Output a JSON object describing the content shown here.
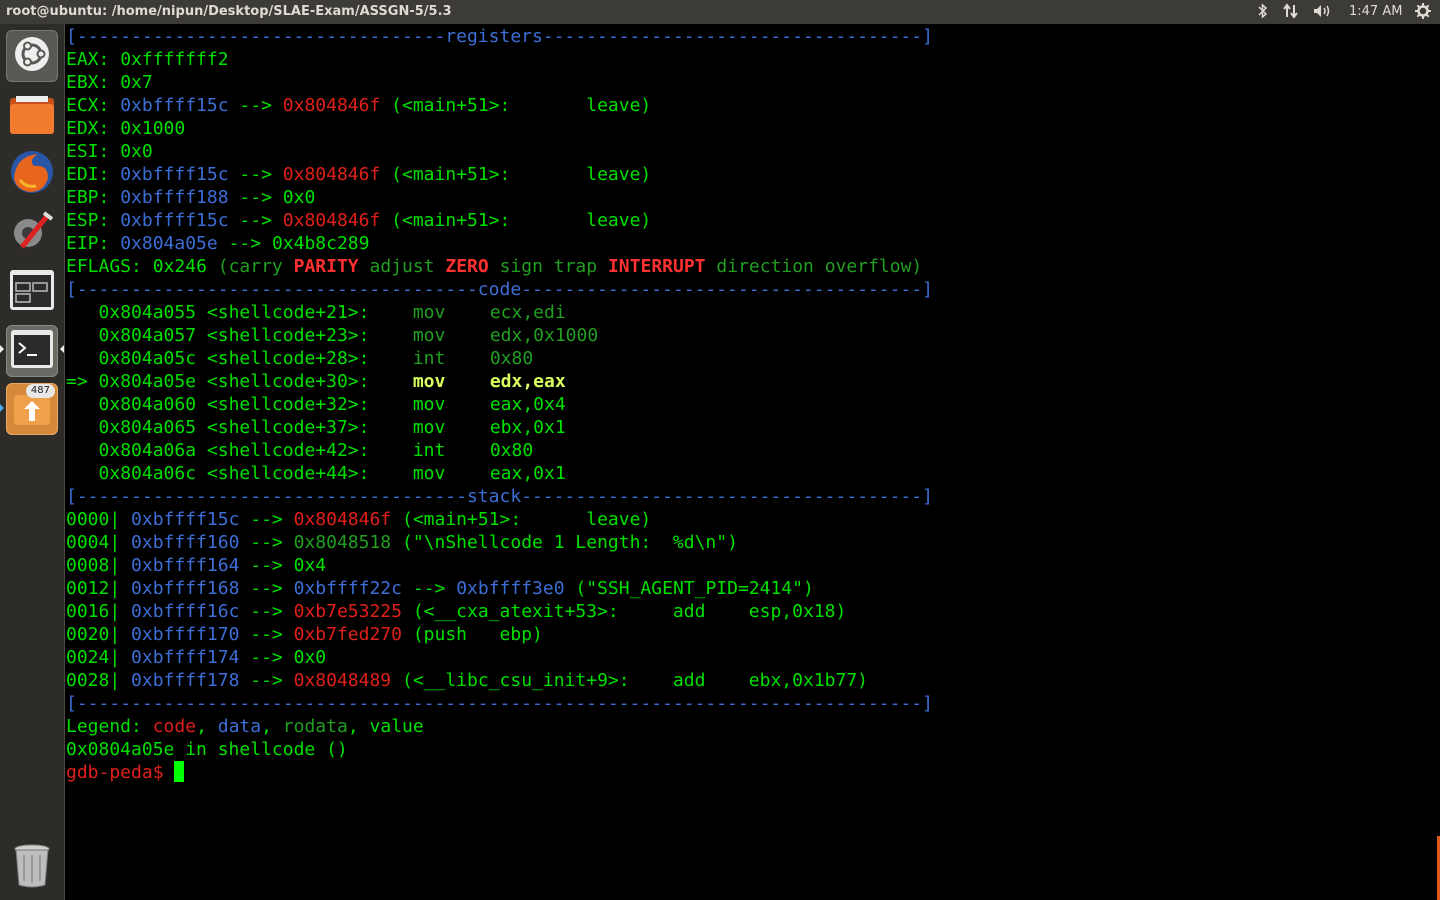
{
  "window": {
    "title": "root@ubuntu: /home/nipun/Desktop/SLAE-Exam/ASSGN-5/5.3"
  },
  "tray": {
    "bluetooth": "bluetooth-icon",
    "network": "network-icon",
    "volume": "volume-icon",
    "clock": "1:47 AM",
    "settings": "gear-icon"
  },
  "launcher": {
    "items": [
      {
        "name": "dash-home",
        "icon": "ubuntu-logo-icon"
      },
      {
        "name": "files",
        "icon": "folder-icon"
      },
      {
        "name": "firefox",
        "icon": "firefox-icon"
      },
      {
        "name": "system-settings",
        "icon": "settings-tools-icon"
      },
      {
        "name": "workspace-switcher",
        "icon": "workspace-icon"
      },
      {
        "name": "terminal",
        "icon": "terminal-icon"
      },
      {
        "name": "software-updater",
        "icon": "updater-icon",
        "badge": "487"
      },
      {
        "name": "trash",
        "icon": "trash-icon"
      }
    ]
  },
  "colors": {
    "blue": "#3d6ed6",
    "red": "#e0201a",
    "green": "#00e000",
    "dim": "#229e22",
    "yellow": "#d8ff60"
  },
  "terminal": {
    "registers_header": "[----------------------------------registers-----------------------------------]",
    "code_header": "[-------------------------------------code-------------------------------------]",
    "stack_header": "[------------------------------------stack-------------------------------------]",
    "end_rule": "[------------------------------------------------------------------------------]",
    "regs": {
      "eax": {
        "n": "EAX",
        "v": "0xfffffff2"
      },
      "ebx": {
        "n": "EBX",
        "v": "0x7"
      },
      "ecx": {
        "n": "ECX",
        "v": "0xbffff15c",
        "arrow": "-->",
        "t": "0x804846f",
        "d": "(<main+51>:       leave)"
      },
      "edx": {
        "n": "EDX",
        "v": "0x1000"
      },
      "esi": {
        "n": "ESI",
        "v": "0x0"
      },
      "edi": {
        "n": "EDI",
        "v": "0xbffff15c",
        "arrow": "-->",
        "t": "0x804846f",
        "d": "(<main+51>:       leave)"
      },
      "ebp": {
        "n": "EBP",
        "v": "0xbffff188",
        "arrow": "-->",
        "t": "0x0"
      },
      "esp": {
        "n": "ESP",
        "v": "0xbffff15c",
        "arrow": "-->",
        "t": "0x804846f",
        "d": "(<main+51>:       leave)"
      },
      "eip": {
        "n": "EIP",
        "v": "0x804a05e",
        "arrow": "-->",
        "t": "0x4b8c289"
      }
    },
    "eflags": {
      "n": "EFLAGS",
      "v": "0x246",
      "f1": "(carry",
      "f2": "PARITY",
      "f3": "adjust",
      "f4": "ZERO",
      "f5": "sign trap",
      "f6": "INTERRUPT",
      "f7": "direction overflow)"
    },
    "code": [
      {
        "m": "   ",
        "a": "0x804a055",
        "s": "<shellcode+21>:",
        "op": "mov",
        "args": "ecx,edi"
      },
      {
        "m": "   ",
        "a": "0x804a057",
        "s": "<shellcode+23>:",
        "op": "mov",
        "args": "edx,0x1000"
      },
      {
        "m": "   ",
        "a": "0x804a05c",
        "s": "<shellcode+28>:",
        "op": "int",
        "args": "0x80"
      },
      {
        "m": "=> ",
        "a": "0x804a05e",
        "s": "<shellcode+30>:",
        "op": "mov",
        "args": "edx,eax"
      },
      {
        "m": "   ",
        "a": "0x804a060",
        "s": "<shellcode+32>:",
        "op": "mov",
        "args": "eax,0x4"
      },
      {
        "m": "   ",
        "a": "0x804a065",
        "s": "<shellcode+37>:",
        "op": "mov",
        "args": "ebx,0x1"
      },
      {
        "m": "   ",
        "a": "0x804a06a",
        "s": "<shellcode+42>:",
        "op": "int",
        "args": "0x80"
      },
      {
        "m": "   ",
        "a": "0x804a06c",
        "s": "<shellcode+44>:",
        "op": "mov",
        "args": "eax,0x1"
      }
    ],
    "stack": [
      {
        "o": "0000|",
        "a": "0xbffff15c",
        "t": "0x804846f",
        "d": "(<main+51>:      leave)"
      },
      {
        "o": "0004|",
        "a": "0xbffff160",
        "t": "0x8048518",
        "d": "(\"\\nShellcode 1 Length:  %d\\n\")"
      },
      {
        "o": "0008|",
        "a": "0xbffff164",
        "t": "0x4"
      },
      {
        "o": "0012|",
        "a": "0xbffff168",
        "t": "0xbffff22c",
        "t2": "0xbffff3e0",
        "d": "(\"SSH_AGENT_PID=2414\")"
      },
      {
        "o": "0016|",
        "a": "0xbffff16c",
        "t": "0xb7e53225",
        "d": "(<__cxa_atexit+53>:     add    esp,0x18)"
      },
      {
        "o": "0020|",
        "a": "0xbffff170",
        "t": "0xb7fed270",
        "d": "(push   ebp)"
      },
      {
        "o": "0024|",
        "a": "0xbffff174",
        "t": "0x0"
      },
      {
        "o": "0028|",
        "a": "0xbffff178",
        "t": "0x8048489",
        "d": "(<__libc_csu_init+9>:    add    ebx,0x1b77)"
      }
    ],
    "arrow": "-->",
    "legend": {
      "label": "Legend:",
      "code": "code",
      "data": "data",
      "rodata": "rodata",
      "value": "value"
    },
    "location": "0x0804a05e in shellcode ()",
    "prompt": "gdb-peda$ "
  }
}
